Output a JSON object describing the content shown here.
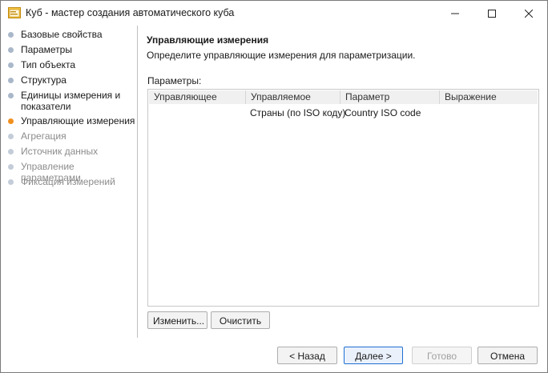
{
  "window": {
    "title": "Куб - мастер создания автоматического куба",
    "controls": [
      "minimize",
      "maximize",
      "close"
    ]
  },
  "steps": [
    {
      "label": "Базовые свойства",
      "state": "done"
    },
    {
      "label": "Параметры",
      "state": "done"
    },
    {
      "label": "Тип объекта",
      "state": "done"
    },
    {
      "label": "Структура",
      "state": "done"
    },
    {
      "label": "Единицы измерения и показатели",
      "state": "done"
    },
    {
      "label": "Управляющие измерения",
      "state": "current"
    },
    {
      "label": "Агрегация",
      "state": "pending"
    },
    {
      "label": "Источник данных",
      "state": "pending"
    },
    {
      "label": "Управление параметрами",
      "state": "pending"
    },
    {
      "label": "Фиксация измерений",
      "state": "pending"
    }
  ],
  "page": {
    "heading": "Управляющие измерения",
    "description": "Определите управляющие измерения для параметризации.",
    "params_label": "Параметры:"
  },
  "grid": {
    "columns": [
      "Управляющее",
      "Управляемое",
      "Параметр",
      "Выражение"
    ],
    "rows": [
      [
        "",
        "Страны (по ISO коду)",
        "Country ISO code",
        ""
      ]
    ]
  },
  "buttons": {
    "edit": "Изменить...",
    "clear": "Очистить",
    "back": "< Назад",
    "next": "Далее >",
    "finish": "Готово",
    "cancel": "Отмена"
  },
  "colors": {
    "current_step_dot": "#f0901f",
    "done_step_dot": "#a9b7c9",
    "pending_step_dot": "#c3ccd8",
    "primary_button_border": "#1f6fd1"
  }
}
